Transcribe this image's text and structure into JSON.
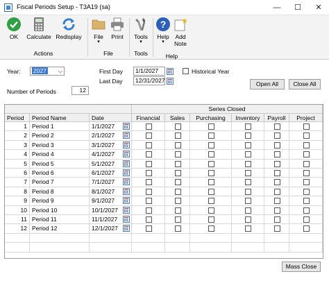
{
  "window": {
    "title": "Fiscal Periods Setup  -  T3A19 (sa)",
    "minimize": "—",
    "maximize": "☐",
    "close": "✕"
  },
  "ribbon": {
    "buttons": {
      "ok": "OK",
      "calculate": "Calculate",
      "redisplay": "Redisplay",
      "file": "File",
      "print": "Print",
      "tools": "Tools",
      "help": "Help",
      "add_note_1": "Add",
      "add_note_2": "Note"
    },
    "groups": {
      "actions": "Actions",
      "file": "File",
      "tools": "Tools",
      "help": "Help"
    },
    "colors": {
      "ok_green": "#2ea043",
      "help_blue": "#2c5fb8",
      "redisplay_blue": "#2f7fd3",
      "calc_gray": "#7a7a7a",
      "folder_tan": "#d9b36a"
    }
  },
  "form": {
    "year_label": "Year:",
    "year_value": "2027",
    "first_day_label": "First Day",
    "first_day_value": "1/1/2027",
    "last_day_label": "Last Day",
    "last_day_value": "12/31/2027",
    "historical_label": "Historical Year",
    "periods_label": "Number of Periods",
    "periods_value": "12",
    "open_all": "Open All",
    "close_all": "Close All",
    "mass_close": "Mass Close"
  },
  "table": {
    "series_header": "Series Closed",
    "columns": [
      "Period",
      "Period Name",
      "Date",
      "Financial",
      "Sales",
      "Purchasing",
      "Inventory",
      "Payroll",
      "Project"
    ],
    "rows": [
      {
        "period": "1",
        "name": "Period 1",
        "date": "1/1/2027"
      },
      {
        "period": "2",
        "name": "Period 2",
        "date": "2/1/2027"
      },
      {
        "period": "3",
        "name": "Period 3",
        "date": "3/1/2027"
      },
      {
        "period": "4",
        "name": "Period 4",
        "date": "4/1/2027"
      },
      {
        "period": "5",
        "name": "Period 5",
        "date": "5/1/2027"
      },
      {
        "period": "6",
        "name": "Period 6",
        "date": "6/1/2027"
      },
      {
        "period": "7",
        "name": "Period 7",
        "date": "7/1/2027"
      },
      {
        "period": "8",
        "name": "Period 8",
        "date": "8/1/2027"
      },
      {
        "period": "9",
        "name": "Period 9",
        "date": "9/1/2027"
      },
      {
        "period": "10",
        "name": "Period 10",
        "date": "10/1/2027"
      },
      {
        "period": "11",
        "name": "Period 11",
        "date": "11/1/2027"
      },
      {
        "period": "12",
        "name": "Period 12",
        "date": "12/1/2027"
      }
    ]
  }
}
